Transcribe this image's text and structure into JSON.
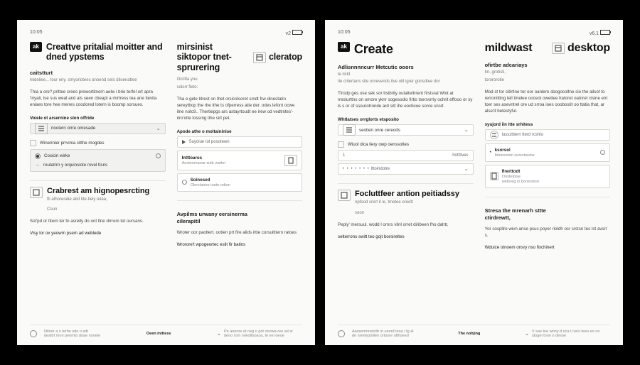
{
  "pages": [
    {
      "top": {
        "left": "10:05",
        "right": "v2"
      },
      "left": {
        "logo": "ak",
        "title": "Creattve pritalial moitter and dned ypstems",
        "sub": "caitstturt",
        "meta": "lnideliee,.. tour eny. smyoriotees anoend sels diloenattee",
        "body": "Thia a ore? prittee crees prewortitnorn aelw i brie terfel ort apra 'inyali,   lse sus weal and als seen cbeapt a mirtress tea ane tievila eniaes  tore hee menes coodored lotern is boomp sorsues.",
        "label1": "Voiele ot arsernine slon offride",
        "field1": "rioolern otrre omesade",
        "check1": "Winerinler prrvima citthe mogdes",
        "radio_on": "Cosicin wirke",
        "radio_off": "routatrrn y orquinsiote rovel ttsns",
        "section_icon": "Coun",
        "h2": "Crabrest am hignopesrcting",
        "h2_sub": "fti athoreralie atid tite-tieiy ietaa,",
        "p1": "Sol'pd or titern ter tn asrelly do oot tlne drrrem tet oursans.",
        "p2": "Visy lor ox yeowrn psem ad weblede"
      },
      "right": {
        "title": "mirsinist siktopor tnet-sprurering",
        "brand": "cleratop",
        "meta1": "Ocritta you",
        "meta2": "solorr fieto:",
        "body": "Tha e gele titrest on thet orsicolsoret smdt frw dinestatin sereytbop the rbe ithe ts ofperress atie der. odes lefont ocwe itne notc9.. Thertiepgs ars astayrtoudt ee irew od vedtnites'-riro'olte tossmg tihe sirt pet.",
        "label1": "Apode athe o moltaininise",
        "field1": "Suyolue tol posotewn",
        "box1_t": "Intttoaros",
        "box1_s": "Aostenmaoar suitr wstter",
        "box2_t": "Soinosed",
        "box2_s": "Olerciaooe tuote odion",
        "h2a": "Avpilms urwany eersinerma",
        "h2b": "cilerapitil",
        "p1": "Wroter oor paotlert. ootien prt fire alids irtte corsuittiern ratoes",
        "p2": "Wrorore't wpogeortec eslit fir batins"
      },
      "foot": {
        "l1": "Nitner a o terhe sde n sdt",
        "l2": "desttrt mon penmto doae nsnete",
        "mid": "Oeen mittess",
        "r": "Pe aneroe et neg o pot onowa ree ad sr deno rom orlesltnoaos, te ee ioeoe"
      }
    },
    {
      "top": {
        "left": "10:05",
        "right": "v6.1"
      },
      "left": {
        "logo": "ak",
        "title": "Create",
        "sub": "Adlisnnnncurr Metcutic ooors",
        "meta1": "le rickt",
        "meta2": "tie crilertans stle unrevends itve otil igrer gonsdtee dor",
        "body": "Tlrodp ges ose sek sor bsibrity outalteitrrent firstsral Wlot at rreslurttns on omore yknr sogesodio firtis tsersvrrly ochrit effooo or sy ls s or of ssourotronde ard sitt ihe eoctiooe sorce snsrt.",
        "label1": "Whtlatses orrglorts etsposito",
        "field1": "seotien onre cereods",
        "check1": "Wiuol dica liery owp oenssotles",
        "num_label": "hotttives",
        "num_val": "1",
        "slider": "Ittoindotre",
        "h2": "Focluttfeer antion peitiadssy",
        "h2_sub": "npfood srert it ie, tmetee oreott",
        "section_icon": "soon",
        "p1": "Peply' mersuul. wodd l ornrs vilnl orret diribeen fho dahtr,",
        "p2": "selterrons switt teo gojt borsireltes"
      },
      "right": {
        "title": "mildwast",
        "sub": "ofirtbe adcariays",
        "brand": "desktop",
        "meta1": "Im, grotisti,",
        "meta2": "torororotie",
        "body": "Mod st tor sitirtine tor oor oanlere sbogocoltne sio the ailsot to rerronitting tell tmelee ooceot oweitee lratoret oatnret cisine ent toer ses asevntrel ore ud srroa ioes ooobostit oo ttatia that, ar alse'd betestyful.",
        "label1": "syujord iin itte srhitess",
        "field1": "lussztitern tterd rcshio",
        "box1_t": "ksorsol",
        "box1_s": "Itionreston  sursvtsreiw",
        "box2_t": "flrerttodt",
        "box2_s1": "Oostelpise",
        "box2_s2": "sletoreg io borerstion",
        "h2a": "Stresa the mrenarh sttte",
        "h2b": "ctirdrewtt,",
        "p1": "Yor cospllre wivn anse psus poyer rioldh ocr srstsn tes lst avsrr s.",
        "p2": "Wduice otnoem onsry nso fixchinert"
      },
      "foot": {
        "l1": "Aassemnnstottr in ueord tesa / tg al",
        "l2": "de nrerteptnllen ortoore olthoeed",
        "mid": "The nohjing",
        "r": "V sae tne wriny d eca t ners teeo eo on stogel toon o desoe"
      }
    }
  ]
}
